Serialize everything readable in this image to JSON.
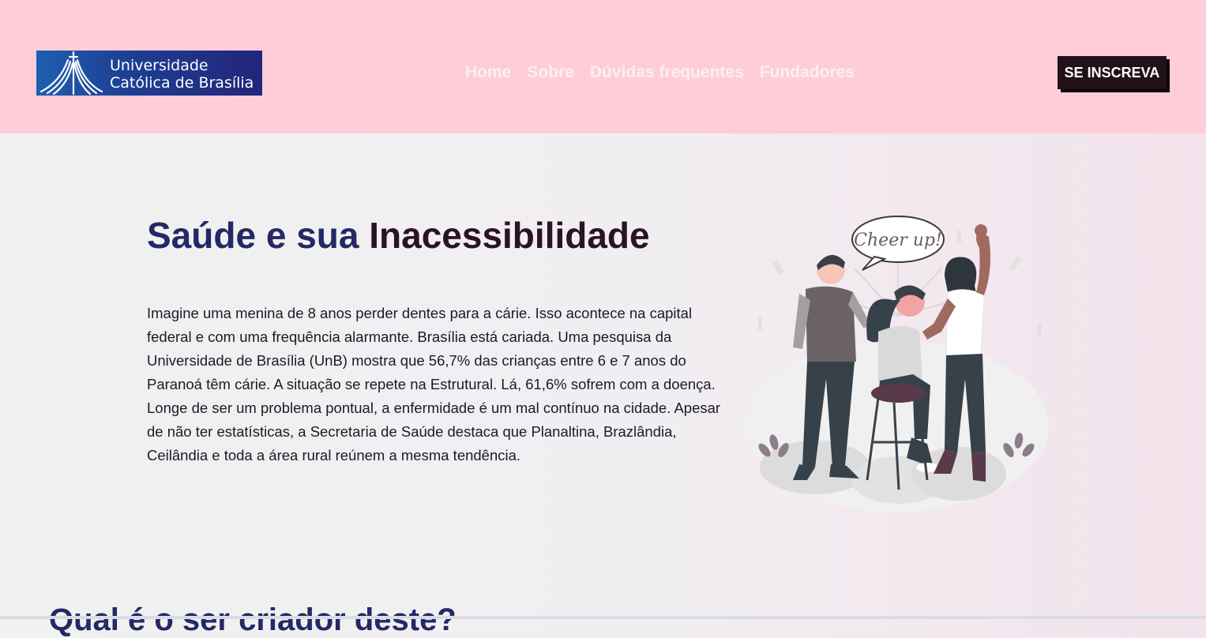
{
  "header": {
    "logo": {
      "line1": "Universidade",
      "line2": "Católica de Brasília"
    },
    "nav": [
      {
        "label": "Home"
      },
      {
        "label": "Sobre"
      },
      {
        "label": "Dúvidas frequentes"
      },
      {
        "label": "Fundadores"
      }
    ],
    "cta_label": "SE INSCREVA"
  },
  "hero": {
    "title_part1": "Saúde e sua",
    "title_part2": "Inacessibilidade",
    "body": "Imagine uma menina de 8 anos perder dentes para a cárie. Isso acontece na capital federal e com uma frequência alarmante. Brasília está cariada. Uma pesquisa da Universidade de Brasília (UnB) mostra que 56,7% das crianças entre 6 e 7 anos do Paranoá têm cárie. A situação se repete na Estrutural. Lá, 61,6% sofrem com a doença. Longe de ser um problema pontual, a enfermidade é um mal contínuo na cidade. Apesar de não ter estatísticas, a Secretaria de Saúde destaca que Planaltina, Brazlândia, Ceilândia e toda a área rural reúnem a mesma tendência.",
    "illustration_bubble": "Cheer up!"
  },
  "next_section": {
    "title": "Qual é o ser criador deste?"
  },
  "colors": {
    "header_bg": "#ffcdd8",
    "nav_text": "#fdeef2",
    "cta_bg": "#221119",
    "title_blue": "#242866",
    "title_dark": "#2a1422"
  }
}
